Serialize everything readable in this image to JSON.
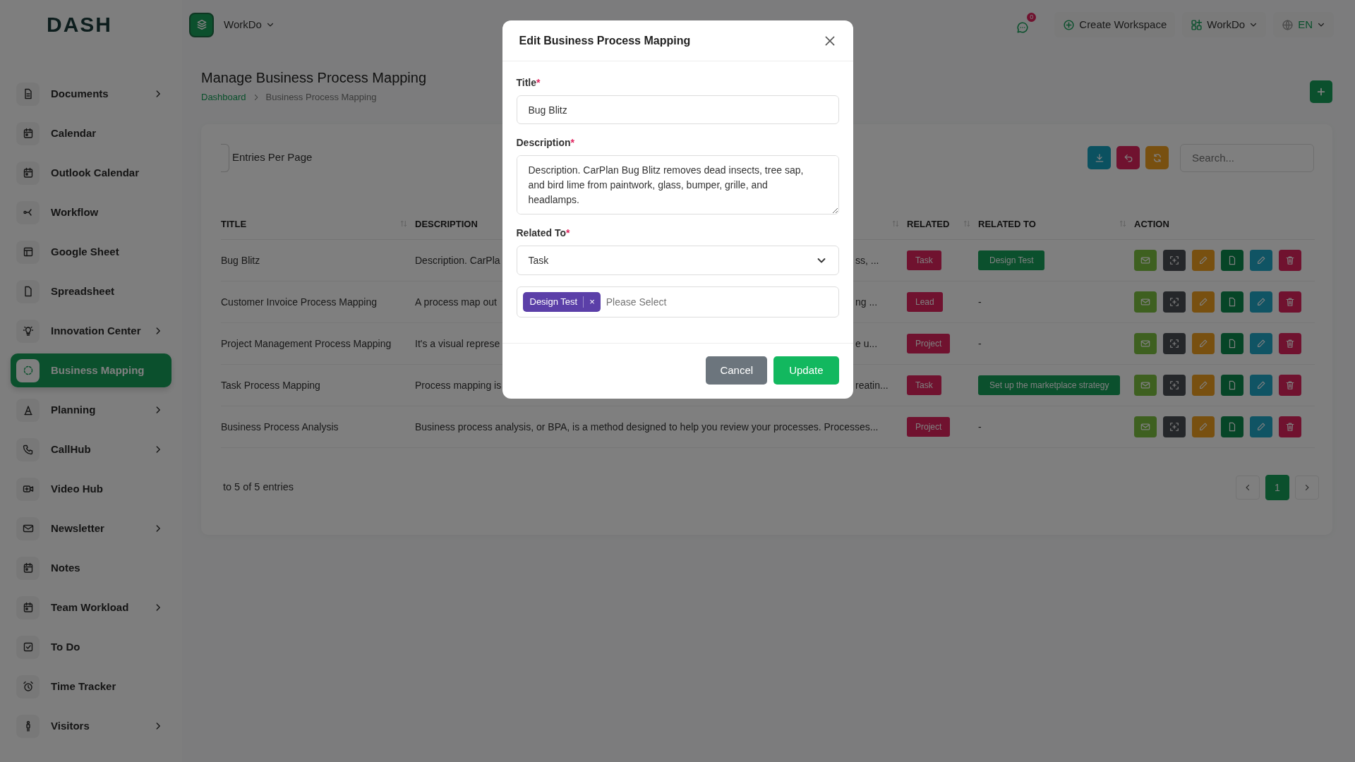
{
  "logo": "DASH",
  "sidebar": {
    "items": [
      {
        "label": "Documents",
        "submenu": true,
        "selected": false
      },
      {
        "label": "Calendar",
        "submenu": false,
        "selected": false
      },
      {
        "label": "Outlook Calendar",
        "submenu": false,
        "selected": false
      },
      {
        "label": "Workflow",
        "submenu": false,
        "selected": false
      },
      {
        "label": "Google Sheet",
        "submenu": false,
        "selected": false
      },
      {
        "label": "Spreadsheet",
        "submenu": false,
        "selected": false
      },
      {
        "label": "Innovation Center",
        "submenu": true,
        "selected": false
      },
      {
        "label": "Business Mapping",
        "submenu": false,
        "selected": true
      },
      {
        "label": "Planning",
        "submenu": true,
        "selected": false
      },
      {
        "label": "CallHub",
        "submenu": true,
        "selected": false
      },
      {
        "label": "Video Hub",
        "submenu": false,
        "selected": false
      },
      {
        "label": "Newsletter",
        "submenu": true,
        "selected": false
      },
      {
        "label": "Notes",
        "submenu": false,
        "selected": false
      },
      {
        "label": "Team Workload",
        "submenu": true,
        "selected": false
      },
      {
        "label": "To Do",
        "submenu": false,
        "selected": false
      },
      {
        "label": "Time Tracker",
        "submenu": false,
        "selected": false
      },
      {
        "label": "Visitors",
        "submenu": true,
        "selected": false
      }
    ]
  },
  "topbar": {
    "workspace": "WorkDo",
    "notifications": "0",
    "create_workspace": "Create Workspace",
    "account": "WorkDo",
    "language": "EN"
  },
  "page": {
    "title": "Manage Business Process Mapping",
    "breadcrumb": [
      "Dashboard",
      "Business Process Mapping"
    ]
  },
  "table": {
    "entries_label": "Entries Per Page",
    "search_placeholder": "Search...",
    "columns": [
      {
        "label": "TITLE",
        "sortable": true
      },
      {
        "label": "DESCRIPTION",
        "sortable": true
      },
      {
        "label": "RELATED",
        "sortable": true
      },
      {
        "label": "RELATED TO",
        "sortable": true
      },
      {
        "label": "ACTION",
        "sortable": false
      }
    ],
    "rows": [
      {
        "title": "Bug Blitz",
        "description": "Description. CarPla",
        "description_tail": "ss, ...",
        "related": "Task",
        "related_to": {
          "kind": "badge",
          "text": "Design Test"
        }
      },
      {
        "title": "Customer Invoice Process Mapping",
        "description": "A process map out",
        "description_tail": "ng ...",
        "related": "Lead",
        "related_to": {
          "kind": "text",
          "text": "-"
        }
      },
      {
        "title": "Project Management Process Mapping",
        "description": "It's a visual represe",
        "description_tail": "e u...",
        "related": "Project",
        "related_to": {
          "kind": "text",
          "text": "-"
        }
      },
      {
        "title": "Task Process Mapping",
        "description": "Process mapping is",
        "description_tail": "reatin...",
        "related": "Task",
        "related_to": {
          "kind": "badge",
          "text": "Set up the marketplace strategy"
        }
      },
      {
        "title": "Business Process Analysis",
        "description": "Business process analysis, or BPA, is a method designed to help you review your processes. Processes...",
        "related": "Project",
        "related_to": {
          "kind": "text",
          "text": "-"
        }
      }
    ],
    "footer": "to 5 of 5 entries",
    "pages": [
      {
        "label": "1",
        "selected": true
      }
    ]
  },
  "modal": {
    "title": "Edit Business Process Mapping",
    "fields": [
      {
        "label": "Title",
        "required_mark": "*",
        "kind": "input",
        "value": "Bug Blitz"
      },
      {
        "label": "Description",
        "required_mark": "*",
        "kind": "textarea",
        "value": "Description. CarPlan Bug Blitz removes dead insects, tree sap, and bird lime from paintwork, glass, bumper, grille, and headlamps."
      },
      {
        "label": "Related To",
        "required_mark": "*",
        "kind": "select",
        "value": "Task"
      },
      {
        "kind": "tags",
        "tags": [
          {
            "text": "Design Test",
            "remove": "×"
          }
        ],
        "placeholder": "Please Select"
      }
    ],
    "buttons": [
      {
        "label": "Cancel",
        "kind": "secondary"
      },
      {
        "label": "Update",
        "kind": "primary"
      }
    ]
  }
}
